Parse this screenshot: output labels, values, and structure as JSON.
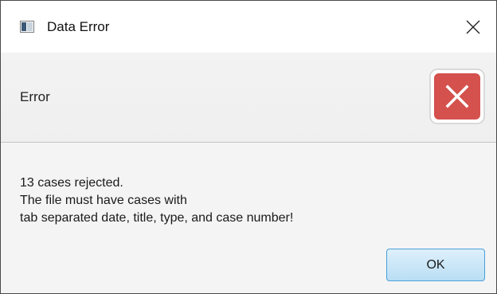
{
  "window": {
    "title": "Data Error",
    "app_icon": "java-window-icon",
    "close_icon": "close-icon"
  },
  "header": {
    "text": "Error",
    "icon": "error-icon",
    "icon_color": "#d9534f"
  },
  "content": {
    "lines": [
      "13 cases rejected.",
      "The file must have cases with",
      "tab separated date, title, type, and case number!"
    ]
  },
  "buttons": {
    "ok_label": "OK",
    "ok_accent": "#4a9fd8"
  }
}
